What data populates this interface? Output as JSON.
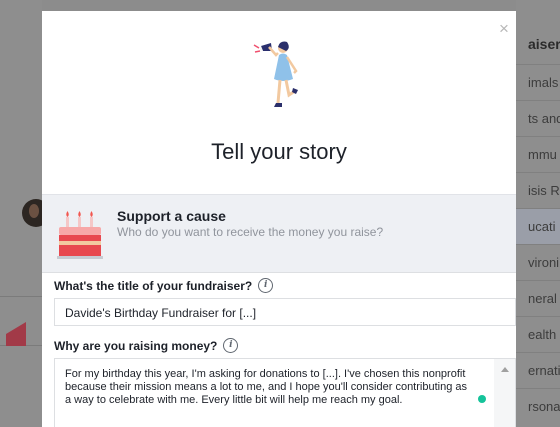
{
  "background": {
    "right_panel": {
      "header": "aiser",
      "items": [
        "imals",
        "ts and",
        "mmu",
        "isis R",
        "ucati",
        "vironi",
        "neral",
        "ealth a",
        "ernati",
        "rsona"
      ]
    }
  },
  "modal": {
    "close_glyph": "×",
    "title": "Tell your story",
    "cause": {
      "title": "Support a cause",
      "subtitle": "Who do you want to receive the money you raise?"
    },
    "fundraiser_title": {
      "label": "What's the title of your fundraiser?",
      "info_glyph": "i",
      "value": "Davide's Birthday Fundraiser for [...]"
    },
    "reason": {
      "label": "Why are you raising money?",
      "info_glyph": "i",
      "value": "For my birthday this year, I'm asking for donations to [...]. I've chosen this nonprofit because their mission means a lot to me, and I hope you'll consider contributing as a way to celebrate with me. Every little bit will help me reach my goal."
    }
  }
}
